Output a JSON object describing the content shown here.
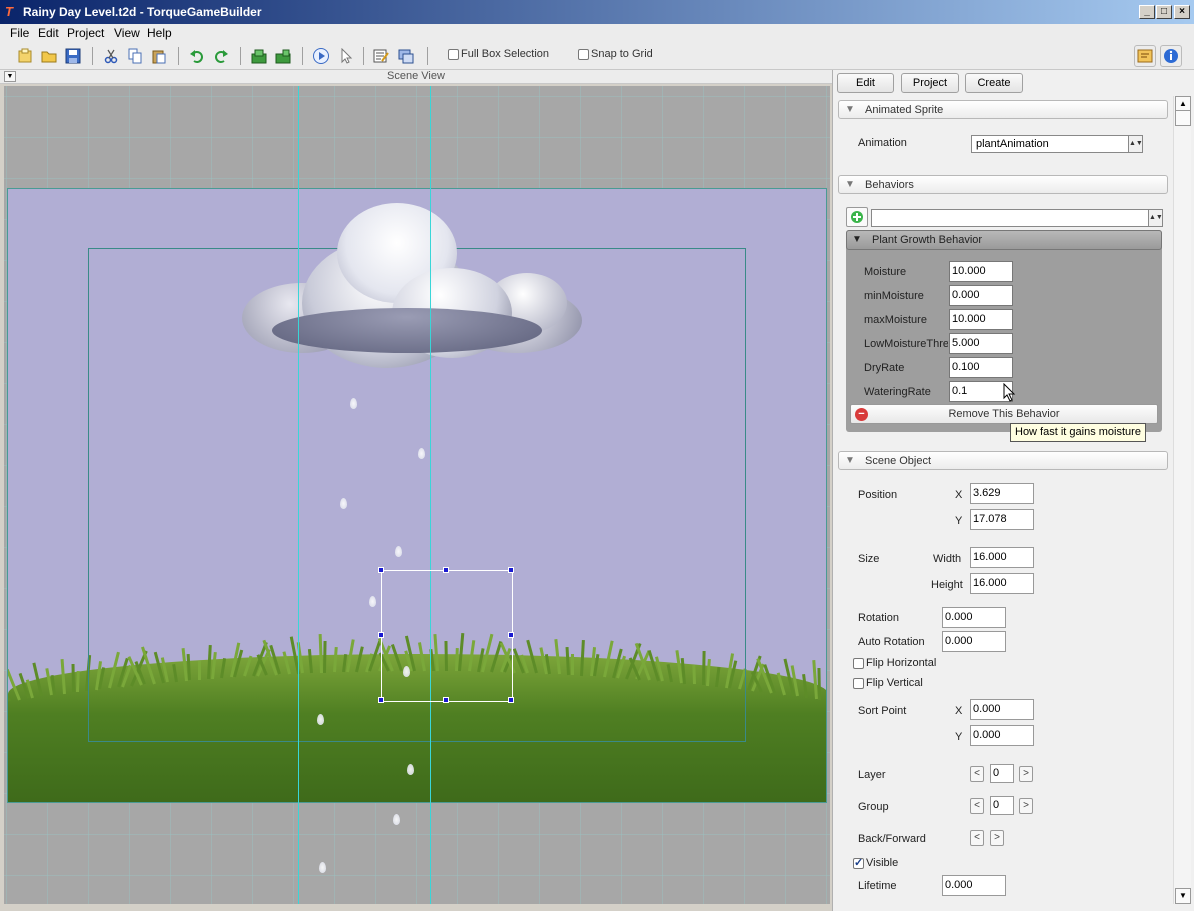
{
  "window": {
    "title": "Rainy Day Level.t2d - TorqueGameBuilder",
    "icon": "torque-icon",
    "controls": {
      "minimize": "_",
      "maximize": "□",
      "close": "×"
    }
  },
  "menu": {
    "items": [
      "File",
      "Edit",
      "Project",
      "View",
      "Help"
    ]
  },
  "toolbar": {
    "full_box_selection": "Full Box Selection",
    "snap_to_grid": "Snap to Grid"
  },
  "scene": {
    "title": "Scene View",
    "colors": {
      "sky": "#b1aed4",
      "grass": "#5a8a26",
      "guides": "#39d6d8"
    }
  },
  "panel": {
    "tabs": [
      "Edit",
      "Project",
      "Create"
    ],
    "animated_sprite": {
      "header": "Animated Sprite",
      "animation_label": "Animation",
      "animation_value": "plantAnimation"
    },
    "behaviors": {
      "header": "Behaviors",
      "add_value": "",
      "behavior_name": "Plant Growth Behavior",
      "fields": [
        {
          "label": "Moisture",
          "value": "10.000"
        },
        {
          "label": "minMoisture",
          "value": "0.000"
        },
        {
          "label": "maxMoisture",
          "value": "10.000"
        },
        {
          "label": "LowMoistureThre",
          "value": "5.000"
        },
        {
          "label": "DryRate",
          "value": "0.100"
        },
        {
          "label": "WateringRate",
          "value": "0.1"
        }
      ],
      "remove_label": "Remove This Behavior",
      "tooltip": "How fast it gains moisture"
    },
    "scene_object": {
      "header": "Scene Object",
      "position_label": "Position",
      "x_label": "X",
      "y_label": "Y",
      "position_x": "3.629",
      "position_y": "17.078",
      "size_label": "Size",
      "width_label": "Width",
      "height_label": "Height",
      "width": "16.000",
      "height": "16.000",
      "rotation_label": "Rotation",
      "rotation": "0.000",
      "auto_rotation_label": "Auto Rotation",
      "auto_rotation": "0.000",
      "flip_h_label": "Flip Horizontal",
      "flip_v_label": "Flip Vertical",
      "sort_point_label": "Sort Point",
      "sort_x": "0.000",
      "sort_y": "0.000",
      "layer_label": "Layer",
      "layer": "0",
      "group_label": "Group",
      "group": "0",
      "back_forward_label": "Back/Forward",
      "visible_label": "Visible",
      "lifetime_label": "Lifetime",
      "lifetime": "0.000",
      "dec": "<",
      "inc": ">"
    }
  }
}
